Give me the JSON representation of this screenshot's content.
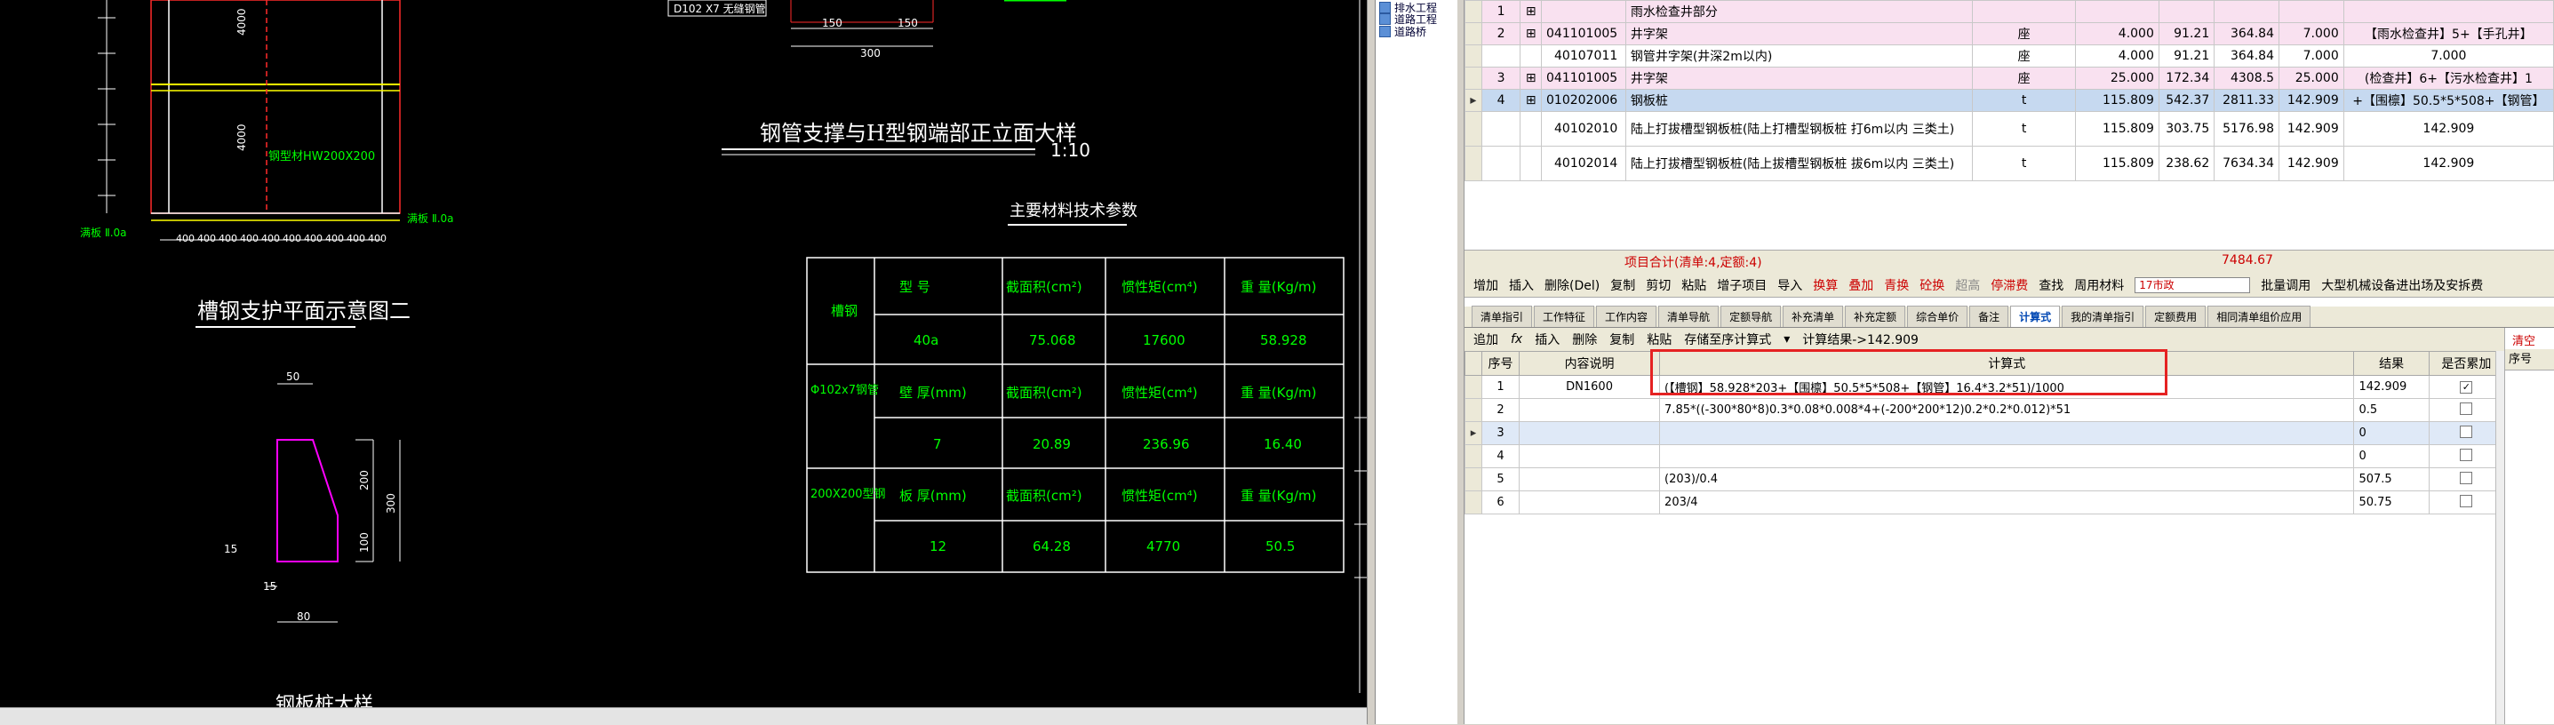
{
  "cad": {
    "top_labels": {
      "left_tag": "D102 X7 无缝钢管",
      "dim_150a": "150",
      "dim_150b": "150",
      "dim_300": "300"
    },
    "left_drawing": {
      "dim_4000_top": "4000",
      "dim_4000_mid": "4000",
      "steel_label": "钢型材HW200X200",
      "bottom_dims": [
        "400",
        "400",
        "400",
        "400",
        "400",
        "400",
        "400",
        "400",
        "400",
        "400"
      ],
      "left_marker": "满板 Ⅱ.0a",
      "right_marker": "满板 Ⅱ.0a"
    },
    "title_elevation": "钢管支撑与H型钢端部正立面大样",
    "scale": "1:10",
    "title_plan2": "槽钢支护平面示意图二",
    "section": {
      "dim_50": "50",
      "dim_200": "200",
      "dim_300": "300",
      "dim_100": "100",
      "dim_15a": "15",
      "dim_15b": "15",
      "dim_80": "80"
    },
    "bottom_title": "钢板桩大样",
    "table_title": "主要材料技术参数",
    "table_rows": [
      {
        "group": "槽钢",
        "c1": "型 号",
        "c2": "截面积(cm²)",
        "c3": "惯性矩(cm⁴)",
        "c4": "重 量(Kg/m)",
        "v1": "40a",
        "v2": "75.068",
        "v3": "17600",
        "v4": "58.928"
      },
      {
        "group": "Φ102x7钢管",
        "c1": "壁 厚(mm)",
        "c2": "截面积(cm²)",
        "c3": "惯性矩(cm⁴)",
        "c4": "重 量(Kg/m)",
        "v1": "7",
        "v2": "20.89",
        "v3": "236.96",
        "v4": "16.40"
      },
      {
        "group": "200X200型钢",
        "c1": "板 厚(mm)",
        "c2": "截面积(cm²)",
        "c3": "惯性矩(cm⁴)",
        "c4": "重 量(Kg/m)",
        "v1": "12",
        "v2": "64.28",
        "v3": "4770",
        "v4": "50.5"
      }
    ]
  },
  "tree": {
    "items": [
      "排水工程",
      "道路工程",
      "道路桥"
    ]
  },
  "upper_rows": [
    {
      "seq": "1",
      "code": "",
      "name": "雨水检查井部分",
      "unit": "",
      "qty": "",
      "price": "",
      "total": "",
      "qty2": "",
      "desc": "",
      "style": "pink"
    },
    {
      "seq": "2",
      "code": "041101005",
      "name": "井字架",
      "unit": "座",
      "qty": "4.000",
      "price": "91.21",
      "total": "364.84",
      "qty2": "7.000",
      "desc": "【雨水检查井】5+【手孔井】",
      "style": "pink"
    },
    {
      "seq": "",
      "code": "40107011",
      "name": "钢管井字架(井深2m以内)",
      "unit": "座",
      "qty": "4.000",
      "price": "91.21",
      "total": "364.84",
      "qty2": "7.000",
      "desc": "7.000",
      "style": "white"
    },
    {
      "seq": "3",
      "code": "041101005",
      "name": "井字架",
      "unit": "座",
      "qty": "25.000",
      "price": "172.34",
      "total": "4308.5",
      "qty2": "25.000",
      "desc": "(检查井】6+【污水检查井】1",
      "style": "pink"
    },
    {
      "seq": "4",
      "code": "010202006",
      "name": "钢板桩",
      "unit": "t",
      "qty": "115.809",
      "price": "542.37",
      "total": "2811.33",
      "qty2": "142.909",
      "desc": "+【围檩】50.5*5*508+【钢管】",
      "style": "sel"
    },
    {
      "seq": "",
      "code": "40102010",
      "name": "陆上打拔槽型钢板桩(陆上打槽型钢板桩 打6m以内 三类土)",
      "unit": "t",
      "qty": "115.809",
      "price": "303.75",
      "total": "5176.98",
      "qty2": "142.909",
      "desc": "142.909",
      "style": "white"
    },
    {
      "seq": "",
      "code": "40102014",
      "name": "陆上打拔槽型钢板桩(陆上拔槽型钢板桩 拔6m以内 三类土)",
      "unit": "t",
      "qty": "115.809",
      "price": "238.62",
      "total": "7634.34",
      "qty2": "142.909",
      "desc": "142.909",
      "style": "white"
    }
  ],
  "summary": {
    "label": "项目合计(清单:4,定额:4)",
    "total": "7484.67"
  },
  "toolbar": {
    "items": [
      "增加",
      "插入",
      "删除(Del)",
      "复制",
      "剪切",
      "粘贴",
      "增子项目",
      "导入"
    ],
    "red_items": [
      "换算",
      "叠加",
      "青换",
      "砼换"
    ],
    "gray_item": "超高",
    "red_item2": "停滞费",
    "items2": [
      "查找",
      "周用材料"
    ],
    "combo": "17市政",
    "items3": [
      "批量调用",
      "大型机械设备进出场及安拆费"
    ]
  },
  "tabs": [
    "清单指引",
    "工作特征",
    "工作内容",
    "清单导航",
    "定额导航",
    "补充清单",
    "补充定额",
    "综合单价",
    "备注",
    "计算式",
    "我的清单指引",
    "定额费用",
    "相同清单组价应用"
  ],
  "active_tab": "计算式",
  "toolbar2": {
    "add": "追加",
    "fx": "fx",
    "insert": "插入",
    "delete": "删除",
    "copy": "复制",
    "paste": "粘贴",
    "store": "存储至序计算式",
    "result": "计算结果->142.909"
  },
  "lower_headers": {
    "seq": "序号",
    "desc": "内容说明",
    "formula": "计算式",
    "result": "结果",
    "acc": "是否累加"
  },
  "lower_rows": [
    {
      "seq": "1",
      "desc": "DN1600",
      "formula": "(【槽钢】58.928*203+【围檩】50.5*5*508+【钢管】16.4*3.2*51)/1000",
      "result": "142.909",
      "checked": true
    },
    {
      "seq": "2",
      "desc": "",
      "formula": "7.85*((-300*80*8)0.3*0.08*0.008*4+(-200*200*12)0.2*0.2*0.012)*51",
      "result": "0.5",
      "checked": false
    },
    {
      "seq": "3",
      "desc": "",
      "formula": "",
      "result": "0",
      "checked": false
    },
    {
      "seq": "4",
      "desc": "",
      "formula": "",
      "result": "0",
      "checked": false
    },
    {
      "seq": "5",
      "desc": "",
      "formula": "(203)/0.4",
      "result": "507.5",
      "checked": false
    },
    {
      "seq": "6",
      "desc": "",
      "formula": "203/4",
      "result": "50.75",
      "checked": false
    }
  ],
  "right_pane": {
    "clear": "清空",
    "seq": "序号"
  }
}
